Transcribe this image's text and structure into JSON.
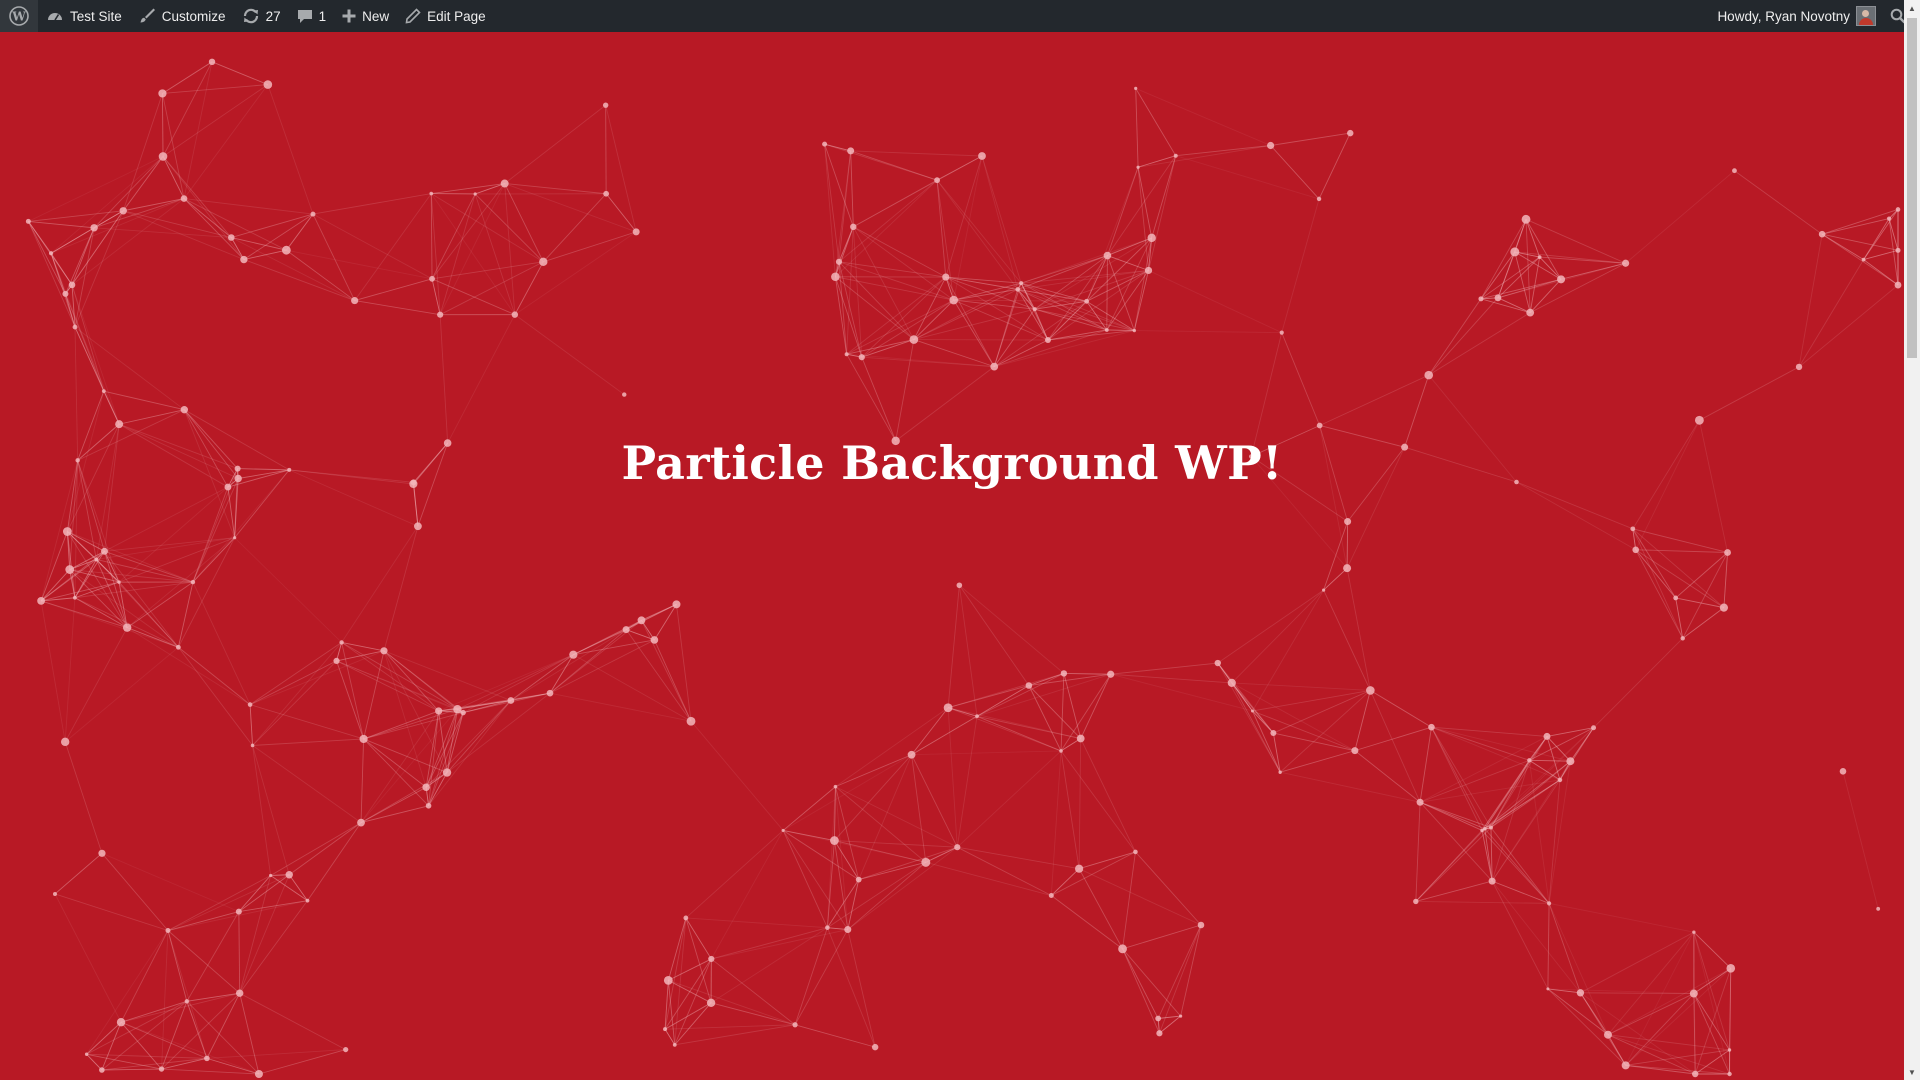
{
  "admin_bar": {
    "wp_logo_icon": "wordpress-logo-icon",
    "site_name": "Test Site",
    "customize_label": "Customize",
    "updates_count": "27",
    "comments_count": "1",
    "new_label": "New",
    "edit_page_label": "Edit Page",
    "greeting": "Howdy, Ryan Novotny",
    "search_icon": "search-icon"
  },
  "hero": {
    "title": "Particle Background WP!"
  },
  "colors": {
    "page_background": "#b81925",
    "admin_bar_background": "#23282d",
    "admin_bar_text": "#eeeeee",
    "particle_color": "#f2b6bb",
    "title_color": "#ffffff"
  }
}
